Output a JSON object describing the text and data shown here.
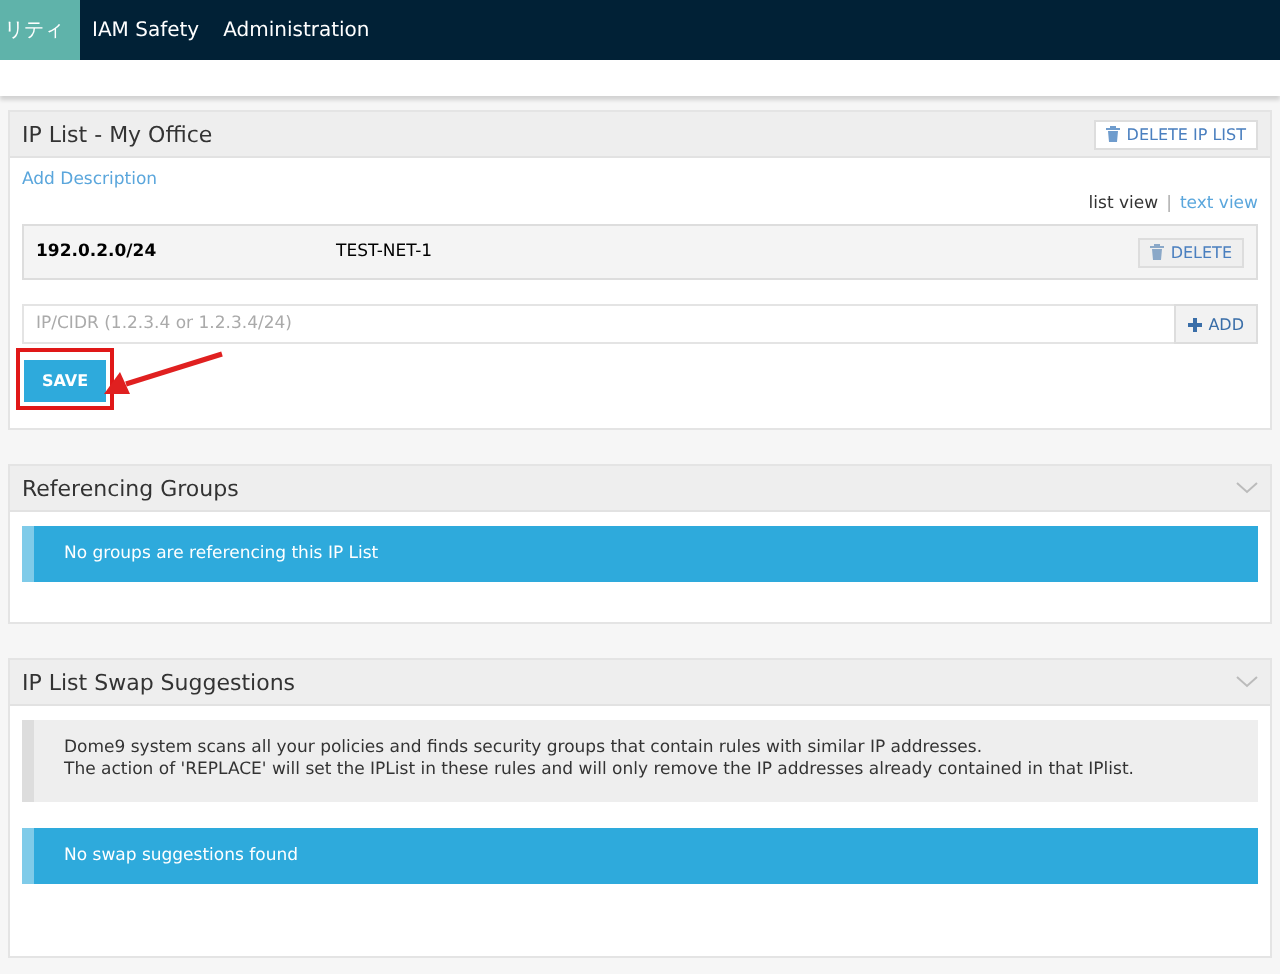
{
  "nav": {
    "tabs": [
      {
        "label": "リティ",
        "selected": true
      },
      {
        "label": "IAM Safety",
        "selected": false
      },
      {
        "label": "Administration",
        "selected": false
      }
    ]
  },
  "ip_list": {
    "title": "IP List - My Office",
    "delete_button": "DELETE IP LIST",
    "add_description": "Add Description",
    "views": [
      {
        "label": "list view",
        "selected": true
      },
      {
        "label": "text view",
        "selected": false
      }
    ],
    "separator": "|",
    "entries": [
      {
        "cidr": "192.0.2.0/24",
        "name": "TEST-NET-1",
        "delete": "DELETE"
      }
    ],
    "input": {
      "placeholder": "IP/CIDR (1.2.3.4 or 1.2.3.4/24)"
    },
    "add_button": "ADD",
    "save_button": "SAVE"
  },
  "referencing_groups": {
    "title": "Referencing Groups",
    "expanded": true,
    "alert": "No groups are referencing this IP List"
  },
  "swap_suggestions": {
    "title": "IP List Swap Suggestions",
    "expanded": true,
    "note": [
      "Dome9 system scans all your policies and finds security groups that contain rules with similar IP addresses.",
      "The action of 'REPLACE' will set the IPList in these rules and will only remove the IP addresses already contained in that IPlist."
    ],
    "alert": "No swap suggestions found"
  }
}
